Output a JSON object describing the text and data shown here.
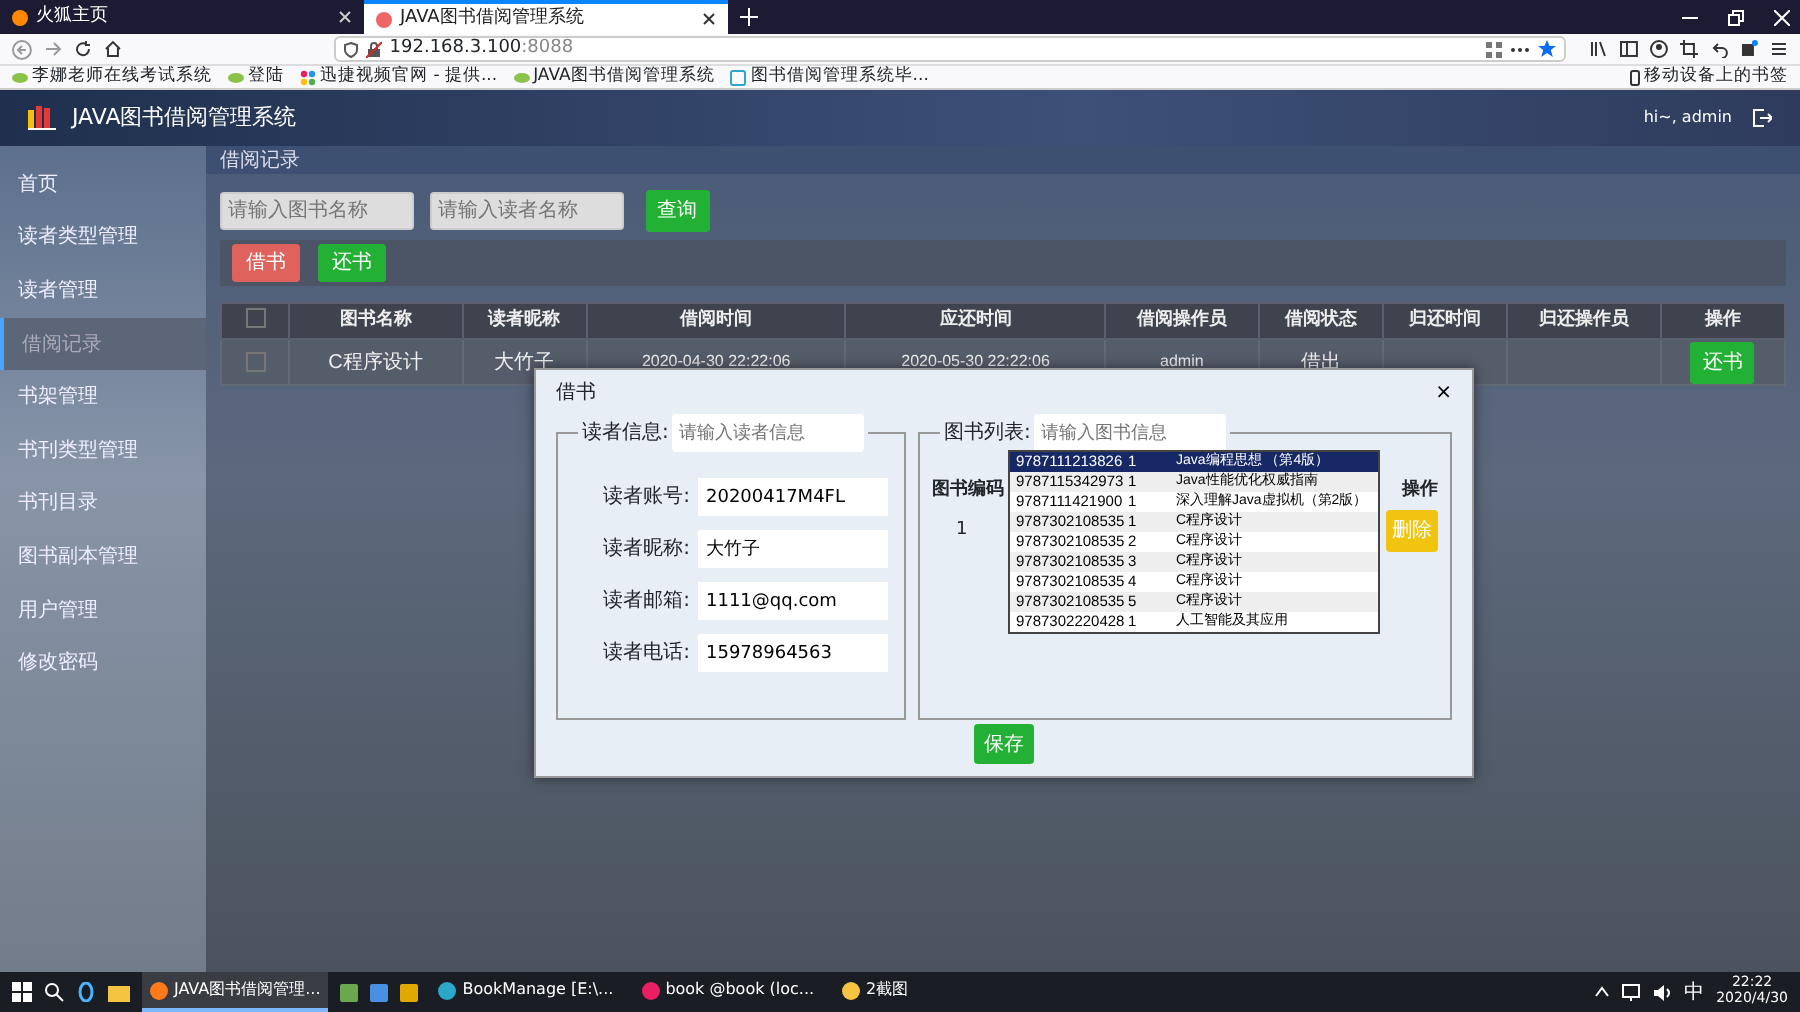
{
  "browser": {
    "tabs": [
      {
        "title": "火狐主页",
        "selected": false
      },
      {
        "title": "JAVA图书借阅管理系统",
        "selected": true
      }
    ],
    "address": {
      "host": "192.168.3.100",
      "port": ":8088"
    },
    "bookmarks": [
      "李娜老师在线考试系统",
      "登陆",
      "迅捷视频官网 - 提供...",
      "JAVA图书借阅管理系统",
      "图书借阅管理系统毕..."
    ],
    "mobile_bookmarks": "移动设备上的书签"
  },
  "app": {
    "title": "JAVA图书借阅管理系统",
    "user": "hi~, admin",
    "sidebar": [
      {
        "label": "首页",
        "selected": false
      },
      {
        "label": "读者类型管理",
        "selected": false
      },
      {
        "label": "读者管理",
        "selected": false
      },
      {
        "label": "借阅记录",
        "selected": true
      },
      {
        "label": "书架管理",
        "selected": false
      },
      {
        "label": "书刊类型管理",
        "selected": false
      },
      {
        "label": "书刊目录",
        "selected": false
      },
      {
        "label": "图书副本管理",
        "selected": false
      },
      {
        "label": "用户管理",
        "selected": false
      },
      {
        "label": "修改密码",
        "selected": false
      }
    ],
    "breadcrumb": "借阅记录",
    "search": [
      {
        "placeholder": "请输入图书名称"
      },
      {
        "placeholder": "请输入读者名称"
      }
    ],
    "query_button": "查询",
    "actions": [
      {
        "label": "借书",
        "kind": "danger"
      },
      {
        "label": "还书",
        "kind": "success"
      }
    ],
    "table": {
      "select_all_checked": false,
      "columns": [
        "图书名称",
        "读者昵称",
        "借阅时间",
        "应还时间",
        "借阅操作员",
        "借阅状态",
        "归还时间",
        "归还操作员",
        "操作"
      ],
      "rows": [
        {
          "checked": false,
          "cells": [
            "C程序设计",
            "大竹子",
            "2020-04-30 22:22:06",
            "2020-05-30 22:22:06",
            "admin",
            "借出",
            "",
            ""
          ],
          "action": "还书"
        }
      ]
    }
  },
  "modal": {
    "title": "借书",
    "close": "×",
    "reader": {
      "legend": "读者信息:",
      "placeholder": "请输入读者信息",
      "fields": [
        {
          "label": "读者账号:",
          "value": "20200417M4FL"
        },
        {
          "label": "读者昵称:",
          "value": "大竹子"
        },
        {
          "label": "读者邮箱:",
          "value": "1111@qq.com"
        },
        {
          "label": "读者电话:",
          "value": "15978964563"
        }
      ]
    },
    "books": {
      "legend": "图书列表:",
      "placeholder": "请输入图书信息",
      "columns": [
        "图书编码",
        "操作"
      ],
      "rows": [
        {
          "code": "1",
          "action": "删除"
        }
      ],
      "suggestions": [
        {
          "isbn": "9787111213826",
          "copy": "1",
          "title": "Java编程思想 （第4版）",
          "selected": true
        },
        {
          "isbn": "9787115342973",
          "copy": "1",
          "title": "Java性能优化权威指南",
          "selected": false
        },
        {
          "isbn": "9787111421900",
          "copy": "1",
          "title": "深入理解Java虚拟机（第2版）",
          "selected": false
        },
        {
          "isbn": "9787302108535",
          "copy": "1",
          "title": "C程序设计",
          "selected": false
        },
        {
          "isbn": "9787302108535",
          "copy": "2",
          "title": "C程序设计",
          "selected": false
        },
        {
          "isbn": "9787302108535",
          "copy": "3",
          "title": "C程序设计",
          "selected": false
        },
        {
          "isbn": "9787302108535",
          "copy": "4",
          "title": "C程序设计",
          "selected": false
        },
        {
          "isbn": "9787302108535",
          "copy": "5",
          "title": "C程序设计",
          "selected": false
        },
        {
          "isbn": "9787302220428",
          "copy": "1",
          "title": "人工智能及其应用",
          "selected": false
        }
      ]
    },
    "save": "保存"
  },
  "taskbar": {
    "apps": [
      {
        "label": "JAVA图书借阅管理...",
        "active": true
      },
      {
        "label": "BookManage [E:\\...",
        "active": false
      },
      {
        "label": "book @book (loc...",
        "active": false
      },
      {
        "label": "2截图",
        "active": false
      }
    ],
    "ime": "中",
    "time": "22:22",
    "date": "2020/4/30"
  }
}
